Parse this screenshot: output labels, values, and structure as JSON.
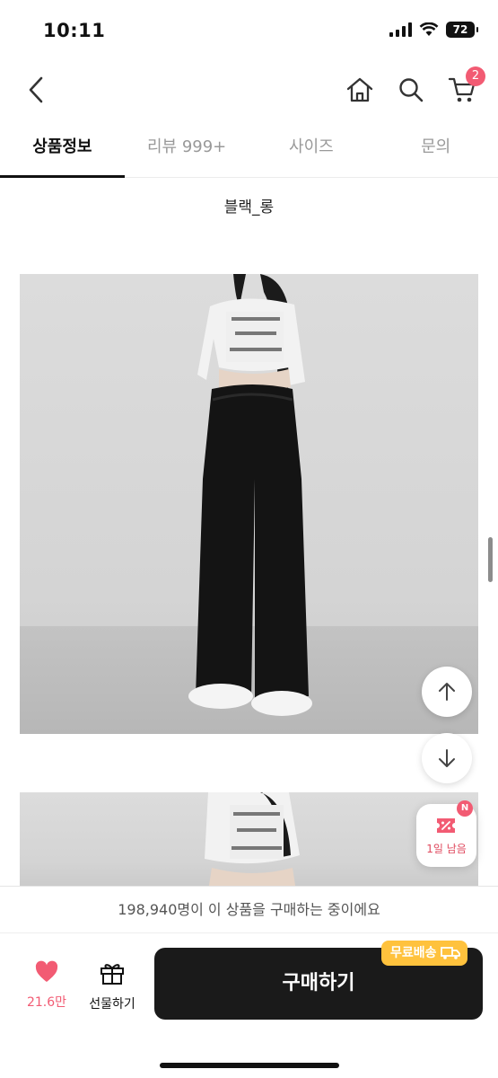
{
  "status": {
    "time": "10:11",
    "battery": "72"
  },
  "header": {
    "cart_count": "2"
  },
  "tabs": [
    {
      "label": "상품정보",
      "active": true
    },
    {
      "label": "리뷰 999+",
      "active": false
    },
    {
      "label": "사이즈",
      "active": false
    },
    {
      "label": "문의",
      "active": false
    }
  ],
  "content": {
    "option_caption": "블랙_롱"
  },
  "floating": {
    "coupon_badge": "N",
    "coupon_label": "1일 남음"
  },
  "bottom": {
    "purchase_note": "198,940명이 이 상품을 구매하는 중이에요",
    "like_count": "21.6만",
    "gift_label": "선물하기",
    "buy_label": "구매하기",
    "shipping_badge": "무료배송"
  },
  "colors": {
    "accent": "#f25b73",
    "buy_button": "#1a1a1a",
    "shipping_badge": "#ffc23d"
  }
}
